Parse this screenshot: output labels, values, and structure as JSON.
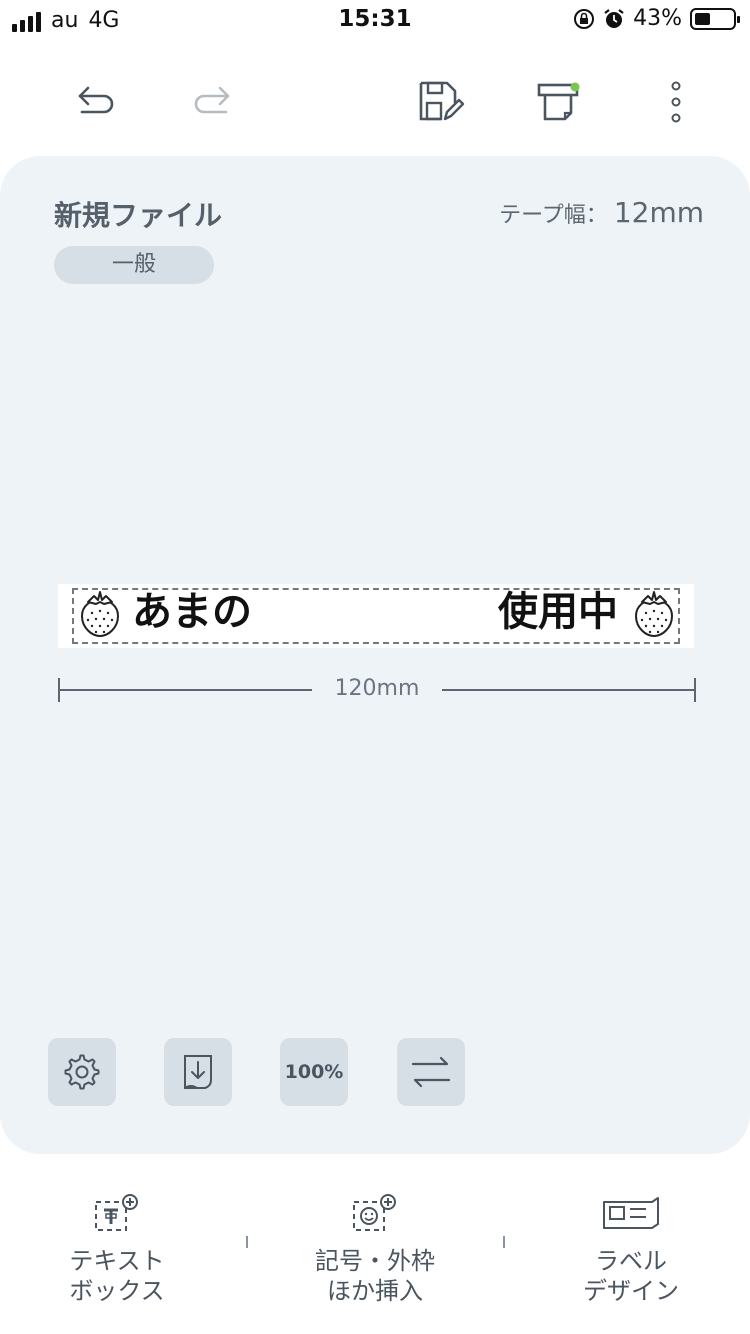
{
  "status_bar": {
    "carrier": "au",
    "network": "4G",
    "time": "15:31",
    "battery_percent": "43%",
    "battery_level": 0.43,
    "icons": [
      "signal-icon",
      "rotation-lock-icon",
      "alarm-icon",
      "battery-icon"
    ]
  },
  "toolbar": {
    "icons": [
      "undo-icon",
      "redo-icon",
      "save-icon",
      "print-icon",
      "more-icon"
    ]
  },
  "document": {
    "file_name": "新規ファイル",
    "tape_width_label": "テープ幅：",
    "tape_width_value": "12mm",
    "category": "一般",
    "label_left_text": "あまの",
    "label_right_text": "使用中",
    "label_icon": "strawberry-icon",
    "length": "120mm"
  },
  "tools": [
    {
      "name": "settings",
      "icon": "gear-icon"
    },
    {
      "name": "export",
      "icon": "download-icon"
    },
    {
      "name": "zoom",
      "label": "100%"
    },
    {
      "name": "direction",
      "icon": "swap-arrows-icon"
    }
  ],
  "bottom_nav": {
    "text_box": {
      "line1": "テキスト",
      "line2": "ボックス",
      "icon": "text-add-icon"
    },
    "symbol": {
      "line1": "記号・外枠",
      "line2": "ほか挿入",
      "icon": "smiley-add-icon"
    },
    "label_design": {
      "line1": "ラベル",
      "line2": "デザイン",
      "icon": "label-design-icon"
    }
  },
  "colors": {
    "card_bg": "#eef3f8",
    "button_bg": "#d6dee6",
    "text": "#4a5560",
    "accent_green": "#7ac74f"
  }
}
